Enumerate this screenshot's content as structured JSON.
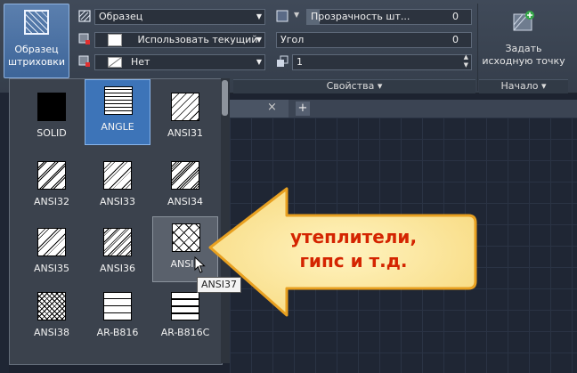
{
  "ribbon": {
    "hatch_button": {
      "line1": "Образец",
      "line2": "штриховки",
      "icon": "hatch-pattern-icon"
    },
    "pattern_combo": {
      "value": "Образец"
    },
    "color_combo": {
      "value": "Использовать текущий",
      "swatch_color": "#ffffff"
    },
    "background_combo": {
      "value": "Нет"
    },
    "transparency": {
      "label": "Прозрачность шт...",
      "value": "0"
    },
    "angle": {
      "label": "Угол",
      "value": "0"
    },
    "scale": {
      "value": "1"
    },
    "properties_panel": {
      "label": "Свойства"
    },
    "origin_button": {
      "line1": "Задать",
      "line2": "исходную точку",
      "icon": "set-origin-icon"
    },
    "origin_panel": {
      "label": "Начало"
    }
  },
  "tabs": {
    "close": "×",
    "add": "+"
  },
  "patterns": [
    {
      "name": "SOLID"
    },
    {
      "name": "ANGLE"
    },
    {
      "name": "ANSI31"
    },
    {
      "name": "ANSI32"
    },
    {
      "name": "ANSI33"
    },
    {
      "name": "ANSI34"
    },
    {
      "name": "ANSI35"
    },
    {
      "name": "ANSI36"
    },
    {
      "name": "ANSI3"
    },
    {
      "name": "ANSI38"
    },
    {
      "name": "AR-B816"
    },
    {
      "name": "AR-B816C"
    }
  ],
  "selected_pattern": "ANGLE",
  "hovered_pattern": "ANSI37",
  "tooltip": "ANSI37",
  "callout": {
    "line1": "утеплители,",
    "line2": "гипс и т.д.",
    "fill_color": "#fde89c",
    "border_color": "#e8a020",
    "text_color": "#d42400"
  },
  "colors": {
    "accent": "#3d74b8",
    "ribbon": "#3a4350",
    "canvas": "#1f2634"
  }
}
